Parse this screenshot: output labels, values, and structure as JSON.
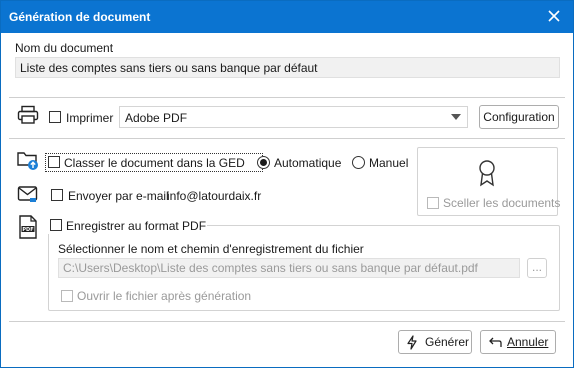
{
  "dialog": {
    "title": "Génération de document"
  },
  "document_name": {
    "label": "Nom du document",
    "value": "Liste des comptes sans tiers ou sans banque par défaut"
  },
  "print": {
    "checkbox_label": "Imprimer",
    "printer_selected": "Adobe PDF",
    "config_button": "Configuration"
  },
  "ged": {
    "checkbox_label": "Classer le document dans la GED",
    "radio_auto": "Automatique",
    "radio_manual": "Manuel",
    "selected": "Automatique"
  },
  "seal": {
    "checkbox_label": "Sceller les documents"
  },
  "email": {
    "checkbox_label": "Envoyer par e-mail",
    "address": "info@latourdaix.fr"
  },
  "pdf": {
    "checkbox_label": "Enregistrer au format PDF",
    "path_label": "Sélectionner le nom et chemin d'enregistrement du fichier",
    "path_value": "C:\\Users\\Desktop\\Liste des comptes sans tiers ou sans banque par défaut.pdf",
    "browse_label": "...",
    "open_after_label": "Ouvrir le fichier après génération"
  },
  "actions": {
    "generate_label": "Générer",
    "cancel_label": "Annuler"
  },
  "colors": {
    "titlebar": "#0b74d1",
    "accent": "#0b74d1"
  }
}
